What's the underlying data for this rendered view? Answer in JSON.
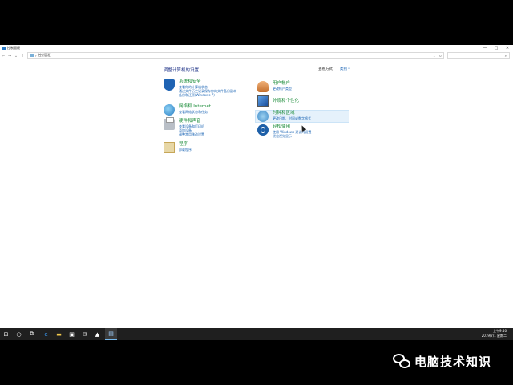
{
  "window": {
    "title": "控制面板",
    "minimize": "—",
    "maximize": "□",
    "close": "✕"
  },
  "address": {
    "back": "←",
    "forward": "→",
    "recent": "⌄",
    "up": "↑",
    "path_sep": "›",
    "path": "控制面板",
    "dropdown": "⌄",
    "refresh": "↻",
    "search_placeholder": "",
    "search_icon": "⌕"
  },
  "main": {
    "heading": "调整计算机的设置",
    "view_by_label": "查看方式:",
    "view_by_value": "类别 ▾"
  },
  "categories_left": [
    {
      "title": "系统和安全",
      "icon": "shield-icon",
      "links": [
        "查看你的计算机状态",
        "通过文件历史记录保存你的文件备份副本",
        "备份和还原(Windows 7)"
      ]
    },
    {
      "title": "网络和 Internet",
      "icon": "globe-icon",
      "links": [
        "查看网络状态和任务"
      ]
    },
    {
      "title": "硬件和声音",
      "icon": "printer-icon",
      "links": [
        "查看设备和打印机",
        "添加设备",
        "调整常用移动设置"
      ]
    },
    {
      "title": "程序",
      "icon": "programs-icon",
      "links": [
        "卸载程序"
      ]
    }
  ],
  "categories_right": [
    {
      "title": "用户帐户",
      "icon": "users-icon",
      "links": [
        "更改帐户类型"
      ]
    },
    {
      "title": "外观和个性化",
      "icon": "appearance-icon",
      "links": []
    },
    {
      "title": "时钟和区域",
      "icon": "clock-icon",
      "links": [
        "更改日期、时间或数字格式"
      ]
    },
    {
      "title": "轻松使用",
      "icon": "accessibility-icon",
      "links": [
        "使用 Windows 建议的设置",
        "优化视觉显示"
      ]
    }
  ],
  "taskbar": {
    "start": "⊞",
    "search": "○",
    "taskview": "⧉",
    "edge": "e",
    "explorer": "▬",
    "store": "▣",
    "mail": "✉",
    "app": "▲",
    "controlpanel": "▤",
    "time": "上午9:40",
    "date": "2019/7/1 星期二"
  },
  "watermark": {
    "text": "电脑技术知识"
  }
}
